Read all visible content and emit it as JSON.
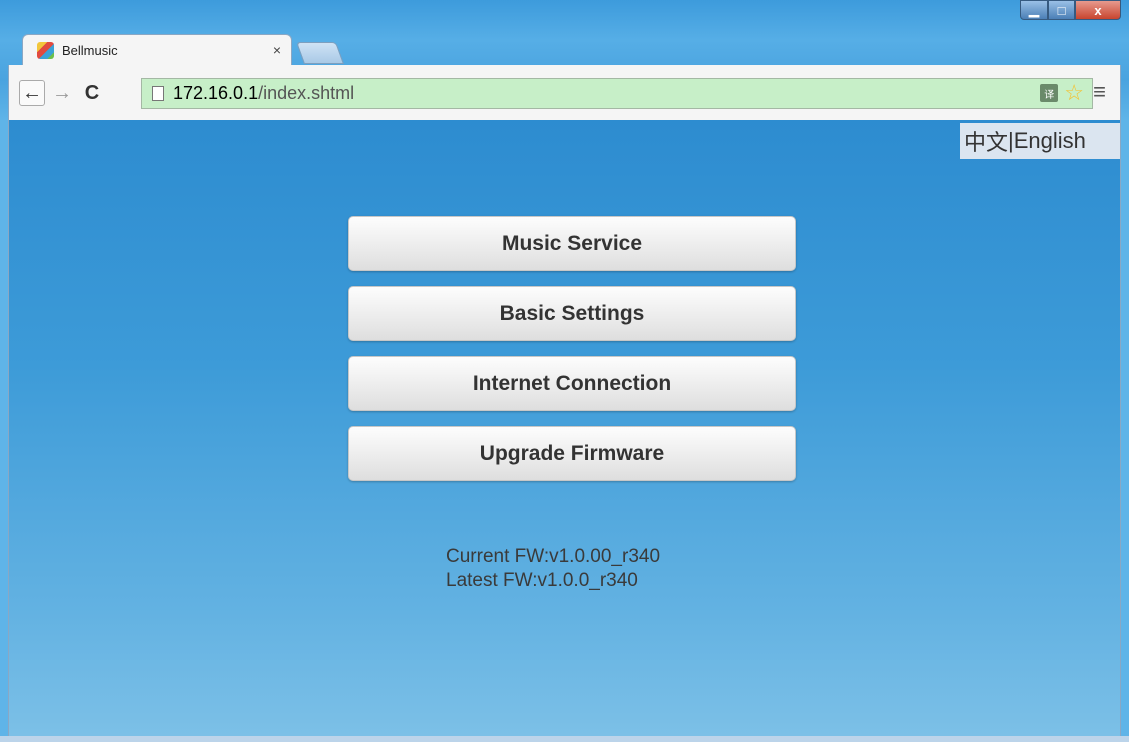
{
  "browser": {
    "window_controls": {
      "minimize": "▁",
      "maximize": "□",
      "close": "x"
    },
    "tab": {
      "title": "Bellmusic",
      "close": "×"
    },
    "toolbar": {
      "back": "←",
      "forward": "→",
      "reload": "C",
      "menu": "≡"
    },
    "address": {
      "host": "172.16.0.1",
      "path": "/index.shtml"
    },
    "icons": {
      "translate": "译",
      "star": "☆"
    }
  },
  "page": {
    "lang_switch": {
      "zh": "中文",
      "sep": " | ",
      "en": "English"
    },
    "menu": [
      {
        "label": "Music Service"
      },
      {
        "label": "Basic Settings"
      },
      {
        "label": "Internet Connection"
      },
      {
        "label": "Upgrade Firmware"
      }
    ],
    "firmware": {
      "current": "Current FW:v1.0.00_r340",
      "latest": "Latest FW:v1.0.0_r340"
    }
  },
  "colors": {
    "accent": "#2d8cd0",
    "omnibox": "#c7efc8"
  }
}
